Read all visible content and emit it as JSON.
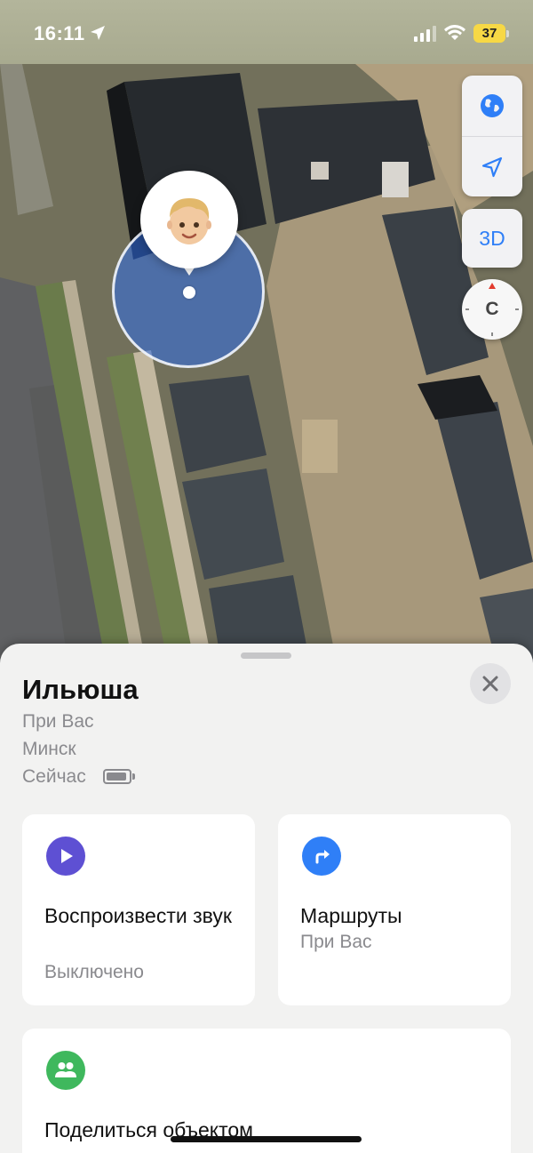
{
  "status_bar": {
    "time": "16:11",
    "battery_level": "37",
    "icons": [
      "location-arrow-icon",
      "cellular-signal-icon",
      "wifi-icon",
      "battery-icon"
    ]
  },
  "map": {
    "view": "satellite",
    "controls": {
      "globe_icon": "globe-icon",
      "locate_icon": "location-arrow-icon",
      "three_d_label": "3D",
      "compass_letter": "С"
    },
    "person_emoji": "👦🏼",
    "accent": "#3a7cf0"
  },
  "sheet": {
    "name": "Ильюша",
    "proximity": "При Вас",
    "city": "Минск",
    "time": "Сейчас",
    "close_icon": "close-icon",
    "cards": {
      "play_sound": {
        "icon": "play-icon",
        "icon_color": "#5e50d3",
        "title": "Воспроизвести звук",
        "subtitle": "Выключено"
      },
      "directions": {
        "icon": "directions-arrow-icon",
        "icon_color": "#2f7ff7",
        "title": "Маршруты",
        "subtitle": "При Вас"
      },
      "share": {
        "icon": "people-icon",
        "icon_color": "#3fb85d",
        "title": "Поделиться объектом"
      }
    }
  }
}
